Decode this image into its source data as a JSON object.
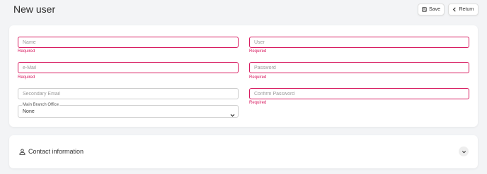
{
  "header": {
    "title": "New user",
    "save_label": "Save",
    "return_label": "Return"
  },
  "form": {
    "name": {
      "placeholder": "Name",
      "value": "",
      "error": "Required"
    },
    "user": {
      "placeholder": "User",
      "value": "",
      "error": "Required"
    },
    "email": {
      "placeholder": "e-Mail",
      "value": "",
      "error": "Required"
    },
    "password": {
      "placeholder": "Password",
      "value": "",
      "error": "Required"
    },
    "secondary_email": {
      "placeholder": "Secondary Email",
      "value": ""
    },
    "confirm_password": {
      "placeholder": "Confirm Password",
      "value": "",
      "error": "Required"
    },
    "branch_office": {
      "label": "Main Branch Office",
      "selected": "None"
    }
  },
  "contact_section": {
    "title": "Contact information"
  },
  "colors": {
    "error": "#d81b60",
    "background": "#f3f4f6",
    "card": "#ffffff"
  },
  "icons": {
    "save": "floppy-disk-icon",
    "return": "chevron-left-icon",
    "contact": "person-icon",
    "expand": "chevron-down-icon",
    "select": "chevron-down-icon"
  }
}
